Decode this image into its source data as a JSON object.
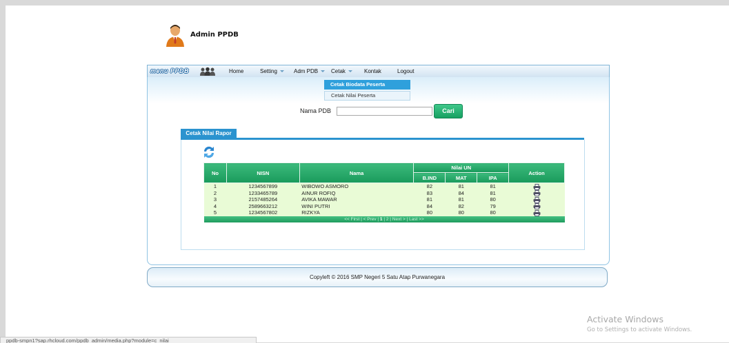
{
  "header": {
    "title": "Admin PPDB"
  },
  "menu": {
    "logo": "menu PPDB",
    "items": [
      {
        "label": "Home"
      },
      {
        "label": "Setting"
      },
      {
        "label": "Adm PDB"
      },
      {
        "label": "Cetak"
      },
      {
        "label": "Kontak"
      },
      {
        "label": "Logout"
      }
    ],
    "dropdown": [
      "Cetak Biodata Peserta",
      "Cetak Nilai Peserta"
    ]
  },
  "search": {
    "label": "Nama PDB",
    "value": "",
    "button": "Cari"
  },
  "tab": {
    "label": "Cetak Nilai Rapor"
  },
  "table": {
    "headers": {
      "no": "No",
      "nisn": "NISN",
      "nama": "Nama",
      "nilai_un": "Nilai UN",
      "bind": "B.IND",
      "mat": "MAT",
      "ipa": "IPA",
      "action": "Action"
    },
    "rows": [
      {
        "no": "1",
        "nisn": "1234567899",
        "nama": "WIBOWO ASMORO",
        "bind": "82",
        "mat": "81",
        "ipa": "81"
      },
      {
        "no": "2",
        "nisn": "1233465789",
        "nama": "AINUR ROFIQ",
        "bind": "83",
        "mat": "84",
        "ipa": "81"
      },
      {
        "no": "3",
        "nisn": "2157485264",
        "nama": "AVIKA MAWAR",
        "bind": "81",
        "mat": "81",
        "ipa": "80"
      },
      {
        "no": "4",
        "nisn": "2589663212",
        "nama": "WINI PUTRI",
        "bind": "84",
        "mat": "82",
        "ipa": "79"
      },
      {
        "no": "5",
        "nisn": "1234567802",
        "nama": "RIZKYA",
        "bind": "80",
        "mat": "80",
        "ipa": "80"
      }
    ],
    "pager": {
      "first": "<< First",
      "prev": "< Prev",
      "page1": "1",
      "page2": "2",
      "next": "Next >",
      "last": "Last >>",
      "sep": "|"
    }
  },
  "footer": {
    "text": "Copyleft © 2016 SMP Negeri 5 Satu Atap Purwanegara"
  },
  "watermark": {
    "title": "Activate Windows",
    "subtitle": "Go to Settings to activate Windows."
  },
  "status_bar": {
    "url": "ppdb-smpn1?sap.rhcloud.com/ppdb_admin/media.php?module=c_nilai"
  },
  "colors": {
    "accent": "#2b93cf",
    "table_header": "#1f9c5e",
    "row_bg": "#e9fbd6",
    "button": "#16a061"
  }
}
